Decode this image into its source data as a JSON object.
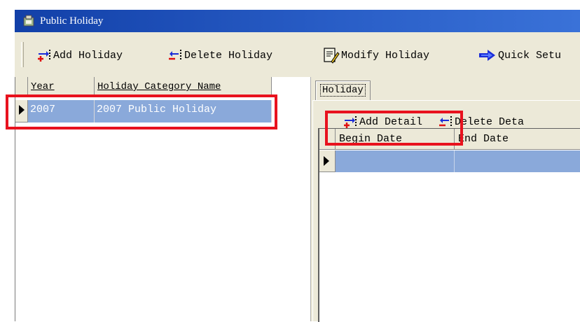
{
  "window": {
    "title": "Public Holiday"
  },
  "toolbar": {
    "add_label": "Add Holiday",
    "delete_label": "Delete Holiday",
    "modify_label": "Modify Holiday",
    "quick_label": "Quick Setu"
  },
  "left_grid": {
    "columns": [
      "Year",
      "Holiday Category Name"
    ],
    "rows": [
      {
        "year": "2007",
        "name": "2007 Public Holiday",
        "selected": true
      }
    ]
  },
  "right_panel": {
    "tab_label": "Holiday",
    "add_detail_label": "Add Detail",
    "delete_detail_label": "Delete Deta",
    "columns": [
      "Begin Date",
      "End Date"
    ]
  },
  "colors": {
    "title_bar": "#1f4fbf",
    "selection": "#8aa9da",
    "highlight": "#e8121e",
    "face": "#ece9d8"
  },
  "icons": [
    "app-icon",
    "add-icon",
    "delete-icon",
    "modify-icon",
    "quick-setup-icon",
    "row-pointer-icon"
  ]
}
